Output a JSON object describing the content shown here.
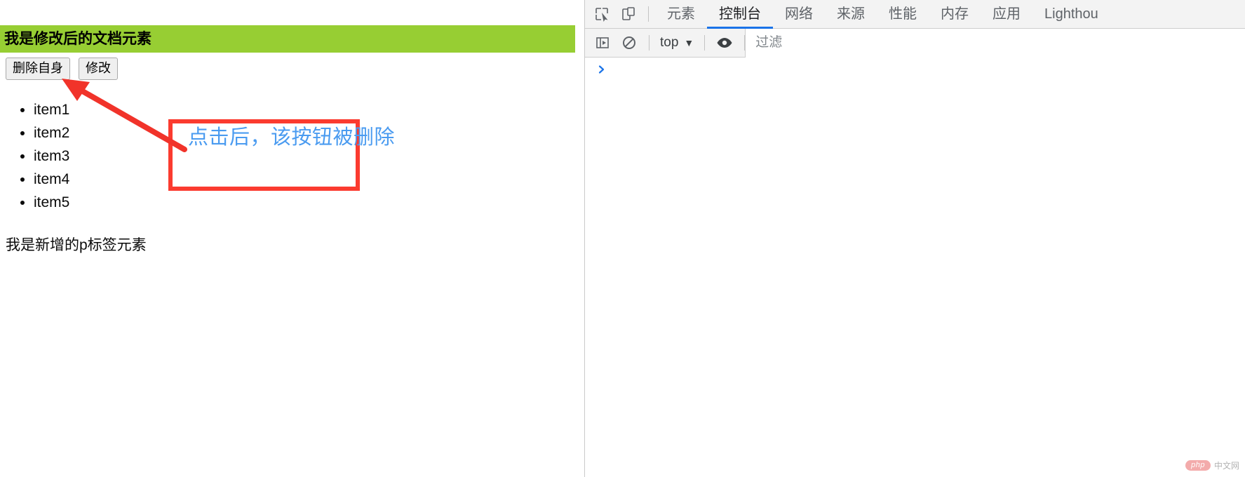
{
  "page": {
    "heading": "我是修改后的文档元素",
    "heading_bg": "#97ce33",
    "buttons": [
      {
        "label": "删除自身",
        "name": "delete-self-button"
      },
      {
        "label": "修改",
        "name": "modify-button"
      }
    ],
    "list_items": [
      "item1",
      "item2",
      "item3",
      "item4",
      "item5"
    ],
    "paragraph": "我是新增的p标签元素"
  },
  "annotation": {
    "text": "点击后，该按钮被删除",
    "text_color": "#4a9bf0",
    "box_color": "#fb3b2f",
    "arrow_color": "#f1332a"
  },
  "devtools": {
    "inspect_icon": "inspect-element-icon",
    "device_icon": "device-toolbar-icon",
    "tabs": [
      {
        "label": "元素",
        "active": false
      },
      {
        "label": "控制台",
        "active": true
      },
      {
        "label": "网络",
        "active": false
      },
      {
        "label": "来源",
        "active": false
      },
      {
        "label": "性能",
        "active": false
      },
      {
        "label": "内存",
        "active": false
      },
      {
        "label": "应用",
        "active": false
      },
      {
        "label": "Lighthou",
        "active": false
      }
    ],
    "active_tab_color": "#1a73e8",
    "toolbar": {
      "sidebar_toggle": "console-sidebar-icon",
      "clear_console": "clear-console-icon",
      "context_value": "top",
      "context_caret": "▼",
      "eye_icon": "live-expression-icon",
      "filter_placeholder": "过滤",
      "filter_value": ""
    },
    "console": {
      "prompt": "❯",
      "input_value": ""
    }
  },
  "watermark": {
    "badge": "php",
    "label": "中文网"
  }
}
